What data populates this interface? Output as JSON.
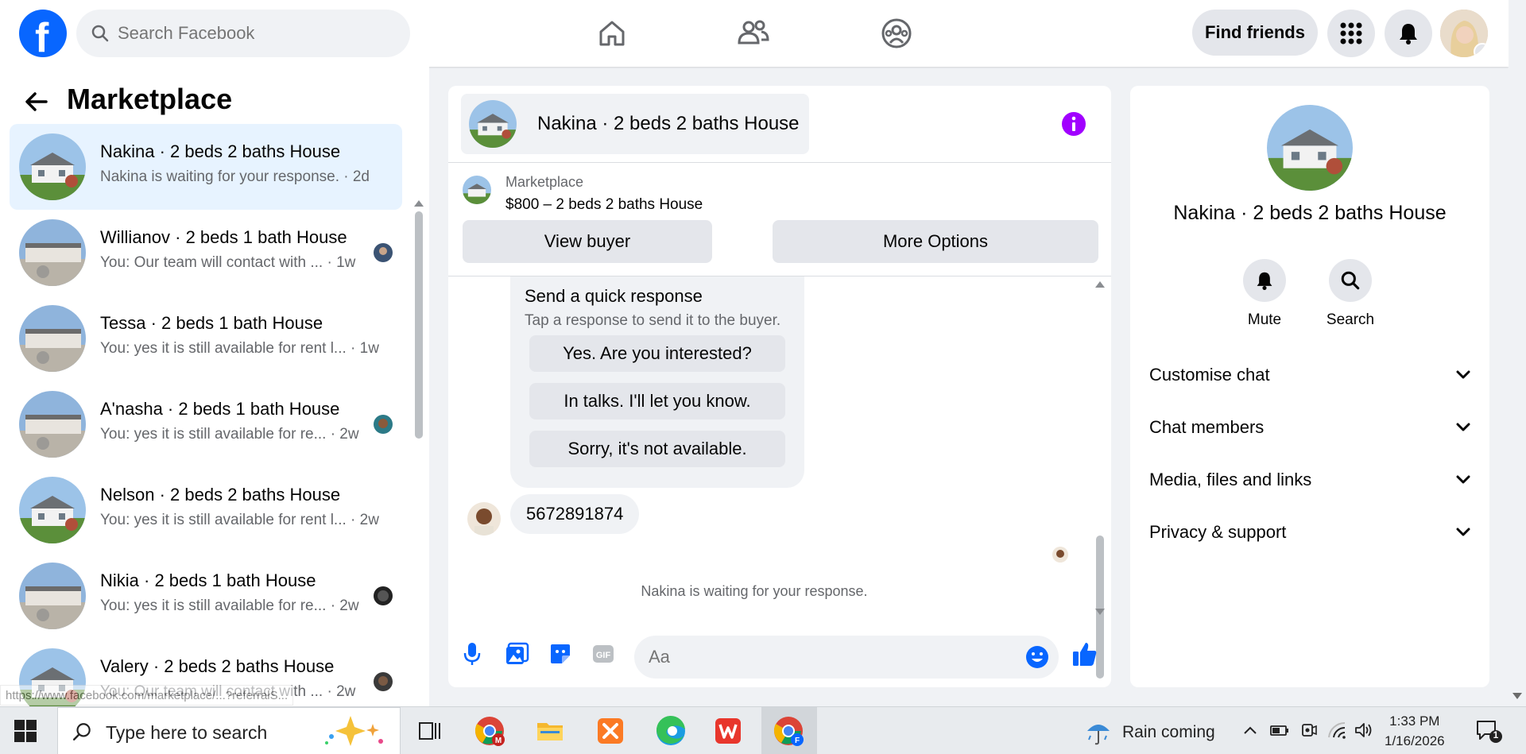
{
  "topbar": {
    "search_placeholder": "Search Facebook",
    "find_friends": "Find friends"
  },
  "sidebar": {
    "title": "Marketplace",
    "conversations": [
      {
        "name": "Nakina · 2 beds 2 baths House",
        "last": "Nakina is waiting for your response. · 2d"
      },
      {
        "name": "Willianov · 2 beds 1 bath House",
        "last": "You: Our team will contact with ... · 1w"
      },
      {
        "name": "Tessa · 2 beds 1 bath House",
        "last": "You: yes it is still available for rent l... · 1w"
      },
      {
        "name": "A'nasha · 2 beds 1 bath House",
        "last": "You: yes it is still available for re... · 2w"
      },
      {
        "name": "Nelson · 2 beds 2 baths House",
        "last": "You: yes it is still available for rent l... · 2w"
      },
      {
        "name": "Nikia · 2 beds 1 bath House",
        "last": "You: yes it is still available for re... · 2w"
      },
      {
        "name": "Valery · 2 beds 2 baths House",
        "last": "You: Our team will contact with ... · 2w"
      }
    ]
  },
  "chat": {
    "title": "Nakina · 2 beds 2 baths House",
    "listing_source": "Marketplace",
    "listing_price": "$800 – 2 beds 2 baths House",
    "view_buyer": "View buyer",
    "more_options": "More Options",
    "quick_title": "Send a quick response",
    "quick_sub": "Tap a response to send it to the buyer.",
    "quick_responses": [
      "Yes. Are you interested?",
      "In talks. I'll let you know.",
      "Sorry, it's not available."
    ],
    "message": "5672891874",
    "waiting": "Nakina is waiting for your response.",
    "input_placeholder": "Aa"
  },
  "details": {
    "title": "Nakina · 2 beds 2 baths House",
    "mute": "Mute",
    "search": "Search",
    "sections": [
      "Customise chat",
      "Chat members",
      "Media, files and links",
      "Privacy & support"
    ]
  },
  "status_url": "https://www.facebook.com/marketplace/...?referralS...",
  "taskbar": {
    "search_text": "Type here to search",
    "weather": "Rain coming",
    "time": "1:33 PM",
    "date": "1/16/2026",
    "notifications": "1"
  },
  "colors": {
    "brand": "#0866ff",
    "accent_purple": "#a100ff",
    "active_bg": "#e7f3ff"
  }
}
